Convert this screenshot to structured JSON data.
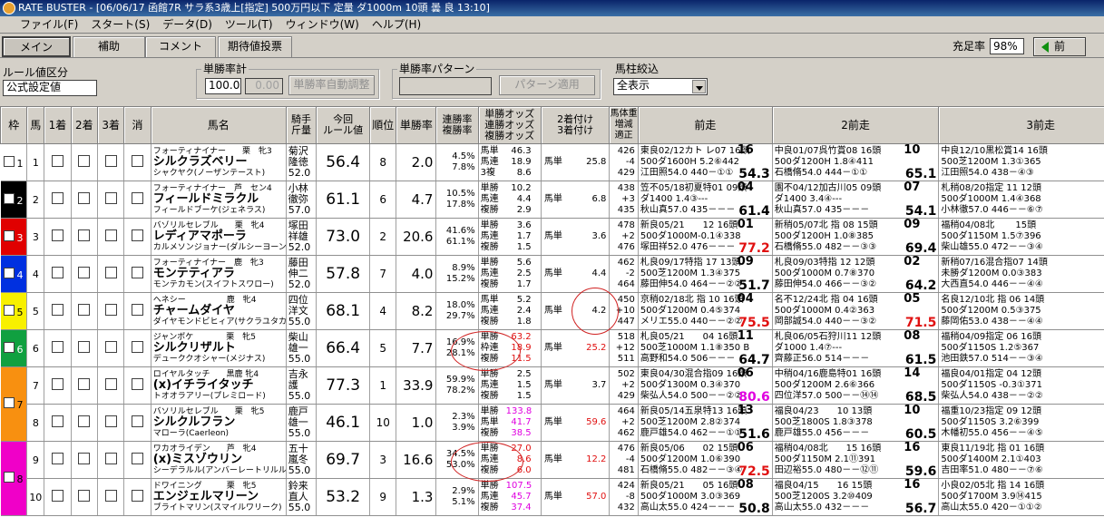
{
  "window": {
    "title": "RATE BUSTER - [06/06/17 函館7R サラ系3歳上[指定] 500万円以下 定量 ダ1000m 10頭 曇 良 13:10]"
  },
  "menu": [
    "ファイル(F)",
    "スタート(S)",
    "データ(D)",
    "ツール(T)",
    "ウィンドウ(W)",
    "ヘルプ(H)"
  ],
  "tabs": [
    "メイン",
    "補助",
    "コメント",
    "期待値投票"
  ],
  "fill_rate": {
    "label": "充足率",
    "value": "98%"
  },
  "prev_button": "前",
  "rule": {
    "label": "ルール値区分",
    "value": "公式設定値"
  },
  "win_rate_total": {
    "label": "単勝率計",
    "value": "100.0",
    "value2": "0.00",
    "auto_button": "単勝率自動調整"
  },
  "pattern": {
    "label": "単勝率パターン",
    "value": "",
    "apply_button": "パターン適用"
  },
  "filter": {
    "label": "馬柱絞込",
    "value": "全表示"
  },
  "headers": {
    "waku": "枠",
    "uma": "馬",
    "p1": "1着",
    "p2": "2着",
    "p3": "3着",
    "kesu": "消",
    "name": "馬名",
    "jockey": "騎手\n斤量",
    "rule": "今回\nルール値",
    "rank": "順位",
    "winrate": "単勝率",
    "ren": "連勝率\n複勝率",
    "odds": "単勝オッズ\n連勝オッズ\n複勝オッズ",
    "place": "2着付け\n3着付け",
    "bw": "馬体重\n増減\n適正",
    "race1": "前走",
    "race2": "2前走",
    "race3": "3前走"
  },
  "waku_colors": [
    "#ffffff",
    "#000000",
    "#e00000",
    "#0030e0",
    "#f8f000",
    "#10a040",
    "#f89010",
    "#f000c8"
  ],
  "horses": [
    {
      "waku": 1,
      "no": "1",
      "top": "フォーティナイナー　　栗　牝3",
      "name": "シルクラズベリー",
      "sub": "シャクヤク(ノーザンテースト)",
      "j1": "菊沢",
      "j2": "隆徳",
      "kin": "52.0",
      "rule": "56.4",
      "rank": "8",
      "win": "2.0",
      "ren": "4.5%",
      "fuku": "7.8%",
      "o1": "46.3",
      "o2": "18.9",
      "o3": "8.6",
      "ok": [
        "馬単",
        "馬連",
        "3複"
      ],
      "pk": "馬単",
      "pv": "25.8",
      "bw1": "426",
      "bw2": "-4",
      "bw3": "429",
      "r1": [
        "東良02/12カト レ07 16頭",
        "500ダ1600H 5.2⑥442",
        "江田照54.0 440－①① "
      ],
      "s1": "54.3",
      "r2": [
        "中良01/07呉竹賞08 16頭",
        "500ダ1200H 1.8④411",
        "石橋脩54.0 444－①① "
      ],
      "s2": "65.1",
      "r3": [
        "中良12/10黒松賞14 16頭",
        "500芝1200M 1.3①365",
        "江田照54.0 438－④③ "
      ],
      "s3": "62.",
      "p1": "16",
      "p2": "10",
      "p3": "13"
    },
    {
      "waku": 2,
      "no": "2",
      "top": "フォーティナイナー　芦　セン4",
      "name": "フィールドミラクル",
      "sub": "フィールドブーケ(ジェネラス)",
      "j1": "小林",
      "j2": "徹弥",
      "kin": "57.0",
      "rule": "61.1",
      "rank": "6",
      "win": "4.7",
      "ren": "10.5%",
      "fuku": "17.8%",
      "o1": "10.2",
      "o2": "4.4",
      "o3": "2.9",
      "ok": [
        "単勝",
        "馬連",
        "複勝"
      ],
      "pk": "馬単",
      "pv": "6.8",
      "bw1": "438",
      "bw2": "+3",
      "bw3": "435",
      "r1": [
        "笠不05/18初夏特01 09頭",
        "ダ1400 1.4③---",
        "秋山真57.0 435－－－ "
      ],
      "s1": "61.4",
      "r2": [
        "園不04/12加古川05 09頭",
        "ダ1400 3.4④---",
        "秋山真57.0 435－－－ "
      ],
      "s2": "54.1",
      "r3": [
        "札稍08/20指定 11 12頭",
        "500ダ1000M 1.4④368",
        "小林徹57.0 446－－⑥⑦ "
      ],
      "s3": "62.",
      "p1": "04",
      "p2": "07",
      "p3": "07"
    },
    {
      "waku": 3,
      "no": "3",
      "top": "バゾリルセレブル　　栗　牝4",
      "name": "レディアマポーラ",
      "sub": "カルメソンジョナー(ダルシーヨーン)",
      "j1": "塚田",
      "j2": "祥雄",
      "kin": "52.0",
      "rule": "73.0",
      "rank": "2",
      "win": "20.6",
      "ren": "41.6%",
      "fuku": "61.1%",
      "o1": "3.6",
      "o2": "1.7",
      "o3": "1.5",
      "ok": [
        "単勝",
        "馬連",
        "複勝"
      ],
      "pk": "馬単",
      "pv": "3.6",
      "bw1": "478",
      "bw2": "+2",
      "bw3": "476",
      "r1": [
        "新良05/21　　12 16頭",
        "500ダ1000M-0.1④338",
        "塚田祥52.0 476－－－ "
      ],
      "s1": "77.2",
      "r2": [
        "新稍05/07北 指 08 15頭",
        "500ダ1200H 1.0⑧385",
        "石橋脩55.0 482－－③③ "
      ],
      "s2": "69.4",
      "r3": [
        "福稍04/08北　　 15頭",
        "500ダ1150M 1.5⑦396",
        "柴山雄55.0 472－－③④ "
      ],
      "s3": "66.",
      "p1": "01",
      "p2": "09",
      "p3": "14"
    },
    {
      "waku": 4,
      "no": "4",
      "top": "フォーティナイナー　鹿　牝3",
      "name": "モンテティアラ",
      "sub": "モンテカモン(スイフトスワロー)",
      "j1": "藤田",
      "j2": "伸二",
      "kin": "52.0",
      "rule": "57.8",
      "rank": "7",
      "win": "4.0",
      "ren": "8.9%",
      "fuku": "15.2%",
      "o1": "5.6",
      "o2": "2.5",
      "o3": "1.7",
      "ok": [
        "単勝",
        "馬連",
        "複勝"
      ],
      "pk": "馬単",
      "pv": "4.4",
      "bw1": "462",
      "bw2": "-2",
      "bw3": "464",
      "r1": [
        "札良09/17特指 17 13頭",
        "500芝1200M 1.3④375",
        "藤田伸54.0 464－－②② "
      ],
      "s1": "51.7",
      "r2": [
        "札良09/03特指 12 12頭",
        "500ダ1000M 0.7⑧370",
        "藤田伸54.0 466－－③② "
      ],
      "s2": "64.2",
      "r3": [
        "新稍07/16混合指07 14頭",
        "未勝ダ1200M 0.0③383",
        "大西直54.0 446－－④④ "
      ],
      "s3": "66.",
      "p1": "09",
      "p2": "02",
      "p3": "01"
    },
    {
      "waku": 5,
      "no": "5",
      "top": "ヘネシー　　　　　鹿　牝4",
      "name": "チャームダイヤ",
      "sub": "ダイヤモンドビヒィア(サクラユタカオー)",
      "j1": "四位",
      "j2": "洋文",
      "kin": "55.0",
      "rule": "68.1",
      "rank": "4",
      "win": "8.2",
      "ren": "18.0%",
      "fuku": "29.7%",
      "o1": "5.2",
      "o2": "2.4",
      "o3": "1.8",
      "ok": [
        "馬単",
        "馬連",
        "複勝"
      ],
      "pk": "馬単",
      "pv": "4.2",
      "bw1": "450",
      "bw2": "+10",
      "bw3": "447",
      "r1": [
        "京稍02/18北 指 10 16頭",
        "500ダ1200M 0.4⑤374",
        "メリエ55.0 440－－②② "
      ],
      "s1": "75.5",
      "r2": [
        "名不12/24北 指 04 16頭",
        "500ダ1000M 0.4②363",
        "岡部誠54.0 440－－③② "
      ],
      "s2": "71.5",
      "r3": [
        "名良12/10北 指 06 14頭",
        "500ダ1200M 0.5③375",
        "藤岡佑53.0 438－－④④ "
      ],
      "s3": "66.",
      "p1": "04",
      "p2": "05",
      "p3": "03"
    },
    {
      "waku": 6,
      "no": "6",
      "top": "ジャンポケ　　　　栗　牝5",
      "name": "シルクリザルト",
      "sub": "デューククオシャー(メジナス)",
      "j1": "柴山",
      "j2": "雄一",
      "kin": "55.0",
      "rule": "66.4",
      "rank": "5",
      "win": "7.7",
      "ren": "16.9%",
      "fuku": "28.1%",
      "o1": "63.2",
      "o2": "18.9",
      "o3": "11.5",
      "ok": [
        "単勝",
        "枠連",
        "複勝"
      ],
      "pk": "馬単",
      "pv": "25.2",
      "bw1": "518",
      "bw2": "+12",
      "bw3": "511",
      "r1": [
        "札良05/21　　04 16頭",
        "500芝1000M 1.1⑧350 B",
        "高野和54.0 506－－－ "
      ],
      "s1": "64.7",
      "r2": [
        "札良06/05石狩川11 12頭",
        "ダ1000 1.4⑦---",
        "齊藤正56.0 514－－－ "
      ],
      "s2": "61.5",
      "r3": [
        "福稍04/09指定 06 16頭",
        "500ダ1150S 1.2⑤367",
        "池田鉄57.0 514－－③④ "
      ],
      "s3": "55.",
      "p1": "11",
      "p2": "08",
      "p3": "11"
    },
    {
      "waku": 7,
      "no": "7",
      "top": "ロイヤルタッチ　　黒鹿 牝4",
      "name": "(x)イチライタッチ",
      "sub": "トオオラアリー(プレミロード)",
      "j1": "吉永",
      "j2": "護",
      "kin": "55.0",
      "rule": "77.3",
      "rank": "1",
      "win": "33.9",
      "ren": "59.9%",
      "fuku": "78.2%",
      "o1": "2.5",
      "o2": "1.5",
      "o3": "1.5",
      "ok": [
        "単勝",
        "馬連",
        "複勝"
      ],
      "pk": "馬単",
      "pv": "3.7",
      "bw1": "502",
      "bw2": "+2",
      "bw3": "429",
      "r1": [
        "東良04/30混合指09 16頭",
        "500ダ1300M 0.3④370",
        "柴弘人54.0 500－－②② "
      ],
      "s1": "80.6",
      "r2": [
        "中稍04/16鹿島特01 16頭",
        "500ダ1200M 2.6⑥366",
        "四位洋57.0 500－－⑭⑭ "
      ],
      "s2": "68.5",
      "r3": [
        "福良04/01指定 04 12頭",
        "500ダ1150S -0.3①371",
        "柴弘人54.0 438－－②② "
      ],
      "s3": "78.",
      "p1": "06",
      "p2": "14",
      "p3": "01"
    },
    {
      "waku": 7,
      "no": "8",
      "top": "バソリルセレブル　　栗　牝5",
      "name": "シルクルフラン",
      "sub": "マローラ(Caerleon)",
      "j1": "鹿戸",
      "j2": "雄一",
      "kin": "55.0",
      "rule": "46.1",
      "rank": "10",
      "win": "1.0",
      "ren": "2.3%",
      "fuku": "3.9%",
      "o1": "133.8",
      "o2": "41.7",
      "o3": "38.5",
      "ok": [
        "単勝",
        "馬単",
        "複勝"
      ],
      "pk": "馬単",
      "pv": "59.6",
      "bw1": "464",
      "bw2": "+2",
      "bw3": "462",
      "r1": [
        "新良05/14五泉特13 16頭",
        "500芝1200M 2.8②374",
        "鹿戸雄54.0 462－－①① "
      ],
      "s1": "51.6",
      "r2": [
        "福良04/23　　10 13頭",
        "500芝1800S 1.8③378",
        "鹿戸雄55.0 456－－－ "
      ],
      "s2": "60.5",
      "r3": [
        "福重10/23指定 09 12頭",
        "500ダ1150S 3.2⑥399",
        "木幡初55.0 456－－④⑤ "
      ],
      "s3": "54.",
      "p1": "13",
      "p2": "10",
      "p3": "11"
    },
    {
      "waku": 8,
      "no": "9",
      "top": "ワカオライデン　　芦　牝4",
      "name": "(x)ミスゾウリン",
      "sub": "シーデラルル(アンバーレートリルル)",
      "j1": "五十",
      "j2": "嵐冬",
      "kin": "55.0",
      "rule": "69.7",
      "rank": "3",
      "win": "16.6",
      "ren": "34.5%",
      "fuku": "53.0%",
      "o1": "27.0",
      "o2": "8.6",
      "o3": "6.0",
      "ok": [
        "単勝",
        "馬連",
        "複勝"
      ],
      "pk": "馬単",
      "pv": "12.2",
      "bw1": "476",
      "bw2": "-4",
      "bw3": "481",
      "r1": [
        "新良05/06　　02 15頭",
        "500ダ1200M 1.0⑥390",
        "石橋脩55.0 482－－③④ "
      ],
      "s1": "72.5",
      "r2": [
        "福稍04/08北　　15 16頭",
        "500ダ1150M 2.1⑪391",
        "田辺裕55.0 480－－⑫⑪ "
      ],
      "s2": "59.6",
      "r3": [
        "東良11/19北 指 01 16頭",
        "500ダ1400M 2.1①403",
        "吉田率51.0 480－－⑦⑥ "
      ],
      "s3": "60.",
      "p1": "06",
      "p2": "16",
      "p3": "12"
    },
    {
      "waku": 8,
      "no": "10",
      "top": "ドワイニング　　　栗　牝5",
      "name": "エンジェルマリーン",
      "sub": "ブライトマリン(スマイルワリーク)",
      "j1": "鈴来",
      "j2": "直人",
      "kin": "55.0",
      "rule": "53.2",
      "rank": "9",
      "win": "1.3",
      "ren": "2.9%",
      "fuku": "5.1%",
      "o1": "107.5",
      "o2": "45.7",
      "o3": "37.4",
      "ok": [
        "単勝",
        "馬連",
        "複勝"
      ],
      "pk": "馬単",
      "pv": "57.0",
      "bw1": "424",
      "bw2": "-8",
      "bw3": "432",
      "r1": [
        "新良05/21　　05 16頭",
        "500ダ1000M 3.0③369",
        "高山太55.0 424－－－ "
      ],
      "s1": "50.8",
      "r2": [
        "福良04/15　　16 15頭",
        "500芝1200S 3.2⑩409",
        "高山太55.0 432－－－ "
      ],
      "s2": "56.7",
      "r3": [
        "小良02/05北 指 14 16頭",
        "500ダ1700M 3.9⑭415",
        "高山太55.0 420－①①② "
      ],
      "s3": "49.",
      "p1": "08",
      "p2": "16",
      "p3": "14"
    }
  ]
}
